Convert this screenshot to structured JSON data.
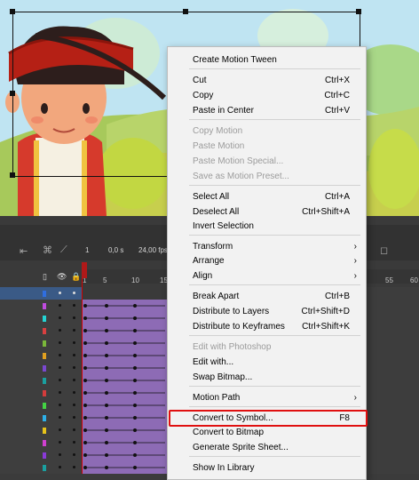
{
  "stage": {
    "bg_sky": "#b9e0f0"
  },
  "timeline": {
    "time_value": "0,0 s",
    "fps_value": "24,00 fps",
    "frame_numbers": [
      "1",
      "5",
      "10",
      "15"
    ],
    "far_numbers": [
      "55",
      "60"
    ],
    "layers": [
      {
        "color": "#2f6ee0"
      },
      {
        "color": "#c04ce0"
      },
      {
        "color": "#24d4d4"
      },
      {
        "color": "#d84040"
      },
      {
        "color": "#7ab83a"
      },
      {
        "color": "#e0a020"
      },
      {
        "color": "#7a48d0"
      },
      {
        "color": "#1aa0a0"
      },
      {
        "color": "#d43c3c"
      },
      {
        "color": "#44d444"
      },
      {
        "color": "#2db0e8"
      },
      {
        "color": "#e6c31a"
      },
      {
        "color": "#d040d0"
      },
      {
        "color": "#8a3ad8"
      },
      {
        "color": "#1aa0a0"
      }
    ]
  },
  "menu": {
    "items": [
      {
        "label": "Create Motion Tween",
        "shortcut": "",
        "arrow": false,
        "disabled": false
      },
      {
        "label": "Cut",
        "shortcut": "Ctrl+X",
        "arrow": false,
        "disabled": false
      },
      {
        "label": "Copy",
        "shortcut": "Ctrl+C",
        "arrow": false,
        "disabled": false
      },
      {
        "label": "Paste in Center",
        "shortcut": "Ctrl+V",
        "arrow": false,
        "disabled": false
      },
      {
        "label": "Copy Motion",
        "shortcut": "",
        "arrow": false,
        "disabled": true
      },
      {
        "label": "Paste Motion",
        "shortcut": "",
        "arrow": false,
        "disabled": true
      },
      {
        "label": "Paste Motion Special...",
        "shortcut": "",
        "arrow": false,
        "disabled": true
      },
      {
        "label": "Save as Motion Preset...",
        "shortcut": "",
        "arrow": false,
        "disabled": true
      },
      {
        "label": "Select All",
        "shortcut": "Ctrl+A",
        "arrow": false,
        "disabled": false
      },
      {
        "label": "Deselect All",
        "shortcut": "Ctrl+Shift+A",
        "arrow": false,
        "disabled": false
      },
      {
        "label": "Invert Selection",
        "shortcut": "",
        "arrow": false,
        "disabled": false
      },
      {
        "label": "Transform",
        "shortcut": "",
        "arrow": true,
        "disabled": false
      },
      {
        "label": "Arrange",
        "shortcut": "",
        "arrow": true,
        "disabled": false
      },
      {
        "label": "Align",
        "shortcut": "",
        "arrow": true,
        "disabled": false
      },
      {
        "label": "Break Apart",
        "shortcut": "Ctrl+B",
        "arrow": false,
        "disabled": false
      },
      {
        "label": "Distribute to Layers",
        "shortcut": "Ctrl+Shift+D",
        "arrow": false,
        "disabled": false
      },
      {
        "label": "Distribute to Keyframes",
        "shortcut": "Ctrl+Shift+K",
        "arrow": false,
        "disabled": false
      },
      {
        "label": "Edit with Photoshop",
        "shortcut": "",
        "arrow": false,
        "disabled": true
      },
      {
        "label": "Edit with...",
        "shortcut": "",
        "arrow": false,
        "disabled": false
      },
      {
        "label": "Swap Bitmap...",
        "shortcut": "",
        "arrow": false,
        "disabled": false
      },
      {
        "label": "Motion Path",
        "shortcut": "",
        "arrow": true,
        "disabled": false
      },
      {
        "label": "Convert to Symbol...",
        "shortcut": "F8",
        "arrow": false,
        "disabled": false
      },
      {
        "label": "Convert to Bitmap",
        "shortcut": "",
        "arrow": false,
        "disabled": false
      },
      {
        "label": "Generate Sprite Sheet...",
        "shortcut": "",
        "arrow": false,
        "disabled": false
      },
      {
        "label": "Show In Library",
        "shortcut": "",
        "arrow": false,
        "disabled": false
      }
    ],
    "highlighted": "Convert to Symbol...",
    "highlight_color": "#e01010"
  }
}
